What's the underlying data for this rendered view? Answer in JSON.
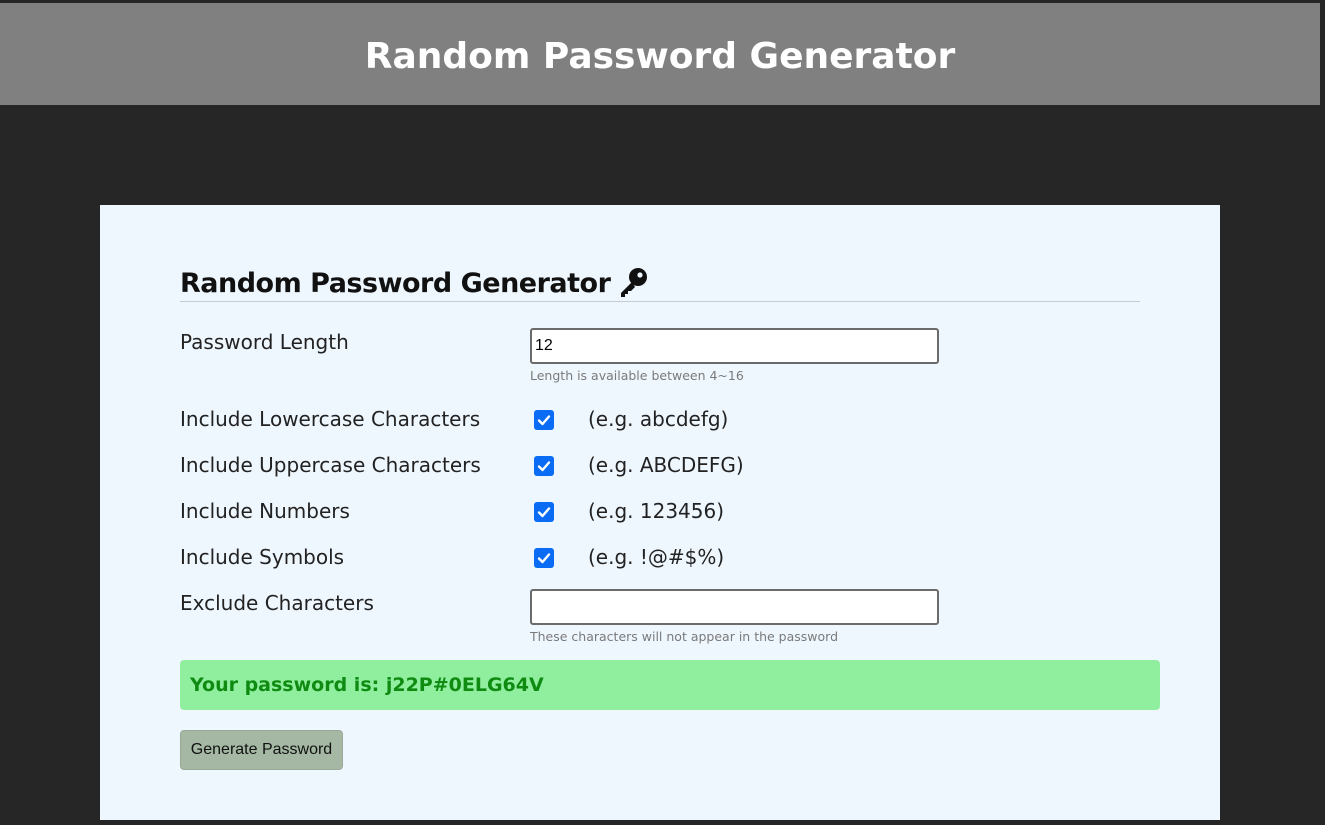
{
  "banner": {
    "title": "Random Password Generator"
  },
  "card": {
    "title": "Random Password Generator",
    "title_icon": "key-icon"
  },
  "length": {
    "label": "Password Length",
    "value": "12",
    "hint": "Length is available between 4~16"
  },
  "options": [
    {
      "label": "Include Lowercase Characters",
      "example": "(e.g. abcdefg)",
      "checked": true
    },
    {
      "label": "Include Uppercase Characters",
      "example": "(e.g. ABCDEFG)",
      "checked": true
    },
    {
      "label": "Include Numbers",
      "example": "(e.g. 123456)",
      "checked": true
    },
    {
      "label": "Include Symbols",
      "example": "(e.g. !@#$%)",
      "checked": true
    }
  ],
  "exclude": {
    "label": "Exclude Characters",
    "value": "",
    "hint": "These characters will not appear in the password"
  },
  "result": {
    "text": "Your password is: j22P#0ELG64V"
  },
  "actions": {
    "generate_label": "Generate Password"
  },
  "colors": {
    "page_background": "#262626",
    "banner_background": "#808080",
    "card_background": "#eff7fe",
    "result_background": "#90ee9f",
    "result_text": "#0f8b12",
    "checkbox_accent": "#0a6cf5",
    "button_background": "#a4b8a4"
  }
}
